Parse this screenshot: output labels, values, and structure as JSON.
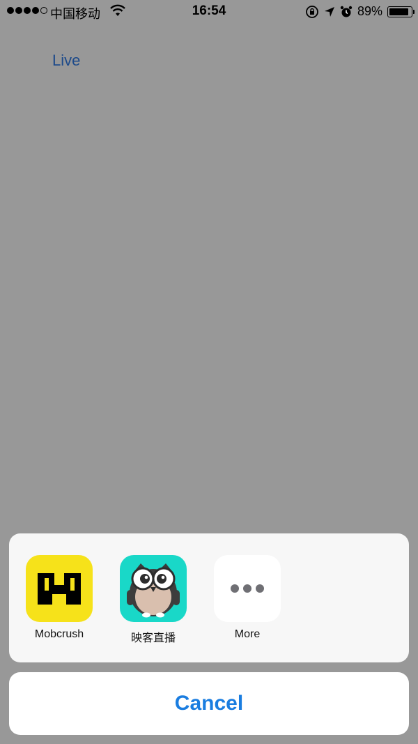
{
  "status_bar": {
    "carrier": "中国移动",
    "time": "16:54",
    "battery_percent": "89%",
    "battery_level": 0.89,
    "icons": [
      "signal-dots",
      "wifi-icon",
      "rotation-lock-icon",
      "location-arrow-icon",
      "alarm-icon",
      "battery-icon"
    ]
  },
  "page": {
    "live_link": "Live"
  },
  "share_sheet": {
    "apps": [
      {
        "name": "Mobcrush",
        "icon": "mobcrush-icon",
        "color": "#f6e21a"
      },
      {
        "name": "映客直播",
        "icon": "inke-owl-icon",
        "color": "#19d8c8"
      },
      {
        "name": "More",
        "icon": "more-dots-icon",
        "color": "#ffffff"
      }
    ],
    "cancel_label": "Cancel"
  },
  "colors": {
    "overlay": "#989898",
    "accent": "#1a7de0",
    "link": "#1d4a8a"
  }
}
